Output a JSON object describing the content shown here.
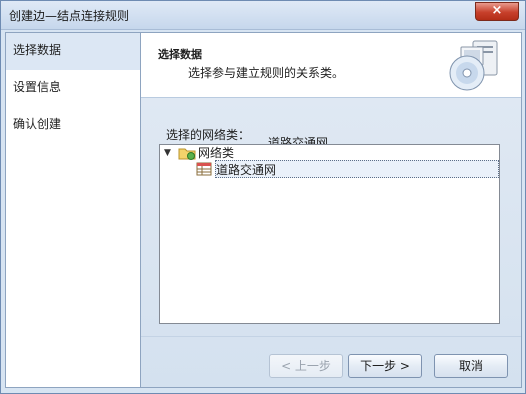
{
  "window": {
    "title": "创建边—结点连接规则",
    "close_icon": "×"
  },
  "sidebar": {
    "items": [
      {
        "label": "选择数据",
        "active": true
      },
      {
        "label": "设置信息",
        "active": false
      },
      {
        "label": "确认创建",
        "active": false
      }
    ]
  },
  "header": {
    "title": "选择数据",
    "description": "选择参与建立规则的关系类。"
  },
  "content": {
    "network_label": "选择的网络类：",
    "floating_label": "道路交通网",
    "tree": {
      "root": {
        "label": "网络类",
        "expander": "▼"
      },
      "child": {
        "label": "道路交通网"
      }
    }
  },
  "buttons": {
    "back": "< 上一步",
    "next": "下一步 >",
    "cancel": "取消"
  },
  "colors": {
    "accent": "#d7e4f2",
    "close": "#c7402b",
    "selection": "#eaf1fa"
  }
}
